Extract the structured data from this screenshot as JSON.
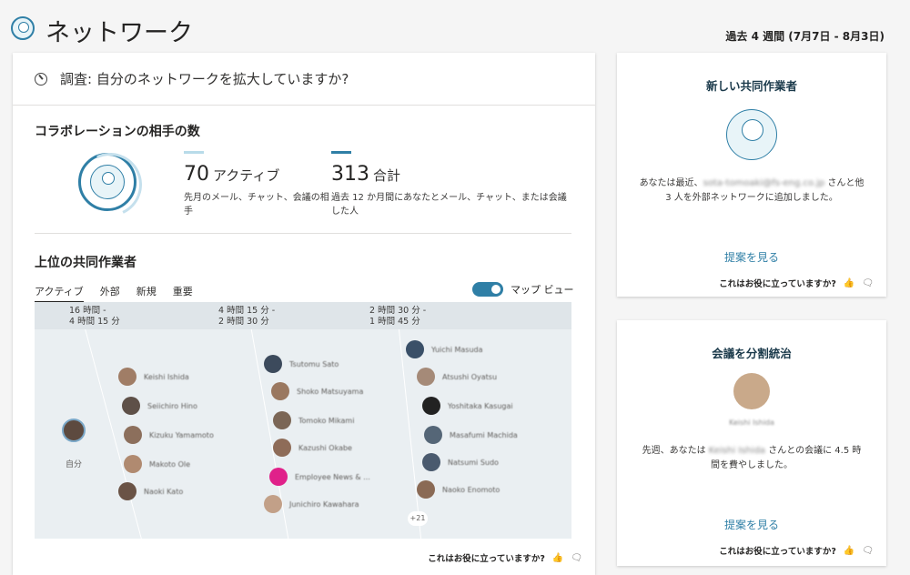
{
  "header": {
    "title": "ネットワーク",
    "period": "過去 4 週間 (7月7日 - 8月3日)"
  },
  "survey": {
    "text": "調査: 自分のネットワークを拡大していますか?"
  },
  "collaborators": {
    "title": "コラボレーションの相手の数",
    "active": {
      "number": "70",
      "label": "アクティブ",
      "desc": "先月のメール、チャット、会議の相手",
      "color": "#b8dbe9"
    },
    "total": {
      "number": "313",
      "label": "合計",
      "desc": "過去 12 か月間にあなたとメール、チャット、または会議した人",
      "color": "#2f7fa6"
    }
  },
  "top": {
    "title": "上位の共同作業者",
    "tabs": [
      "アクティブ",
      "外部",
      "新規",
      "重要"
    ],
    "toggle_label": "マップ ビュー",
    "columns": [
      {
        "line1": "16 時間 -",
        "line2": "4 時間 15 分"
      },
      {
        "line1": "4 時間 15 分 -",
        "line2": "2 時間 30 分"
      },
      {
        "line1": "2 時間 30 分 -",
        "line2": "1 時間 45 分"
      }
    ],
    "me_label": "自分",
    "people_col1": [
      "Keishi Ishida",
      "Seiichiro Hino",
      "Kizuku Yamamoto",
      "Makoto Ole",
      "Naoki Kato"
    ],
    "people_col2": [
      "Tsutomu Sato",
      "Shoko Matsuyama",
      "Tomoko Mikami",
      "Kazushi Okabe",
      "Employee News & ...",
      "Junichiro Kawahara"
    ],
    "people_col3": [
      "Yuichi Masuda",
      "Atsushi Oyatsu",
      "Yoshitaka Kasugai",
      "Masafumi Machida",
      "Natsumi Sudo",
      "Naoko Enomoto"
    ],
    "more": "+21"
  },
  "feedback": {
    "text": "これはお役に立っていますか?",
    "up": "👍",
    "down": "🗨"
  },
  "card1": {
    "title": "新しい共同作業者",
    "text_before": "あなたは最近、",
    "blurred": "sota-tomoaki@fs-eng.co.jp",
    "text_after": " さんと他 3 人を外部ネットワークに追加しました。",
    "link": "提案を見る"
  },
  "card2": {
    "title": "会議を分割統治",
    "photo_name": "Keishi Ishida",
    "text_before": "先週、あなたは ",
    "blurred": "Keishi Ishida",
    "text_after": " さんとの会議に 4.5 時間を費やしました。",
    "link": "提案を見る"
  }
}
